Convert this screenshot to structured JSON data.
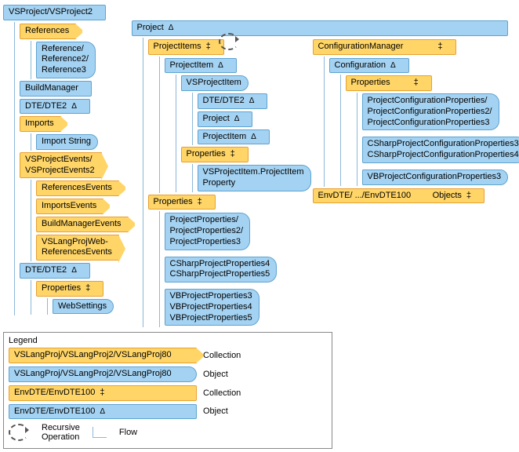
{
  "colA": {
    "root": "VSProject/VSProject2",
    "references": "References",
    "references_obj": "Reference/\nReference2/\nReference3",
    "build_manager": "BuildManager",
    "dte": "DTE/DTE2",
    "imports": "Imports",
    "import_string": "Import String",
    "events": "VSProjectEvents/\nVSProjectEvents2",
    "ref_events": "ReferencesEvents",
    "imp_events": "ImportsEvents",
    "bm_events": "BuildManagerEvents",
    "vslang_events": "VSLangProjWeb-\nReferencesEvents",
    "dte2": "DTE/DTE2",
    "properties": "Properties",
    "websettings": "WebSettings"
  },
  "colB": {
    "project": "Project",
    "project_items": "ProjectItems",
    "project_item": "ProjectItem",
    "vsproject_item": "VSProjectItem",
    "dte": "DTE/DTE2",
    "project_ref": "Project",
    "project_item_ref": "ProjectItem",
    "props1": "Properties",
    "vsp_item_prop": "VSProjectItem.ProjectItem\nProperty",
    "props2": "Properties",
    "proj_props": "ProjectProperties/\nProjectProperties2/\nProjectProperties3",
    "csharp_props": "CSharpProjectProperties4\nCSharpProjectProperties5",
    "vb_props": "VBProjectProperties3\nVBProjectProperties4\nVBProjectProperties5"
  },
  "colC": {
    "config_mgr": "ConfigurationManager",
    "config": "Configuration",
    "props": "Properties",
    "pcp": "ProjectConfigurationProperties/\nProjectConfigurationProperties2/\nProjectConfigurationProperties3",
    "csharp_pcp": "CSharpProjectConfigurationProperties3\nCSharpProjectConfigurationProperties4",
    "vb_pcp": "VBProjectConfigurationProperties3",
    "envdte": "EnvDTE/ .../EnvDTE100         Objects"
  },
  "legend": {
    "title": "Legend",
    "r1_label": "VSLangProj/VSLangProj2/VSLangProj80",
    "r1_type": "Collection",
    "r2_label": "VSLangProj/VSLangProj2/VSLangProj80",
    "r2_type": "Object",
    "r3_label": "EnvDTE/EnvDTE100",
    "r3_type": "Collection",
    "r4_label": "EnvDTE/EnvDTE100",
    "r4_type": "Object",
    "recursive": "Recursive\nOperation",
    "flow": "Flow"
  },
  "sym": {
    "delta": "Δ",
    "dbl": "‡"
  }
}
